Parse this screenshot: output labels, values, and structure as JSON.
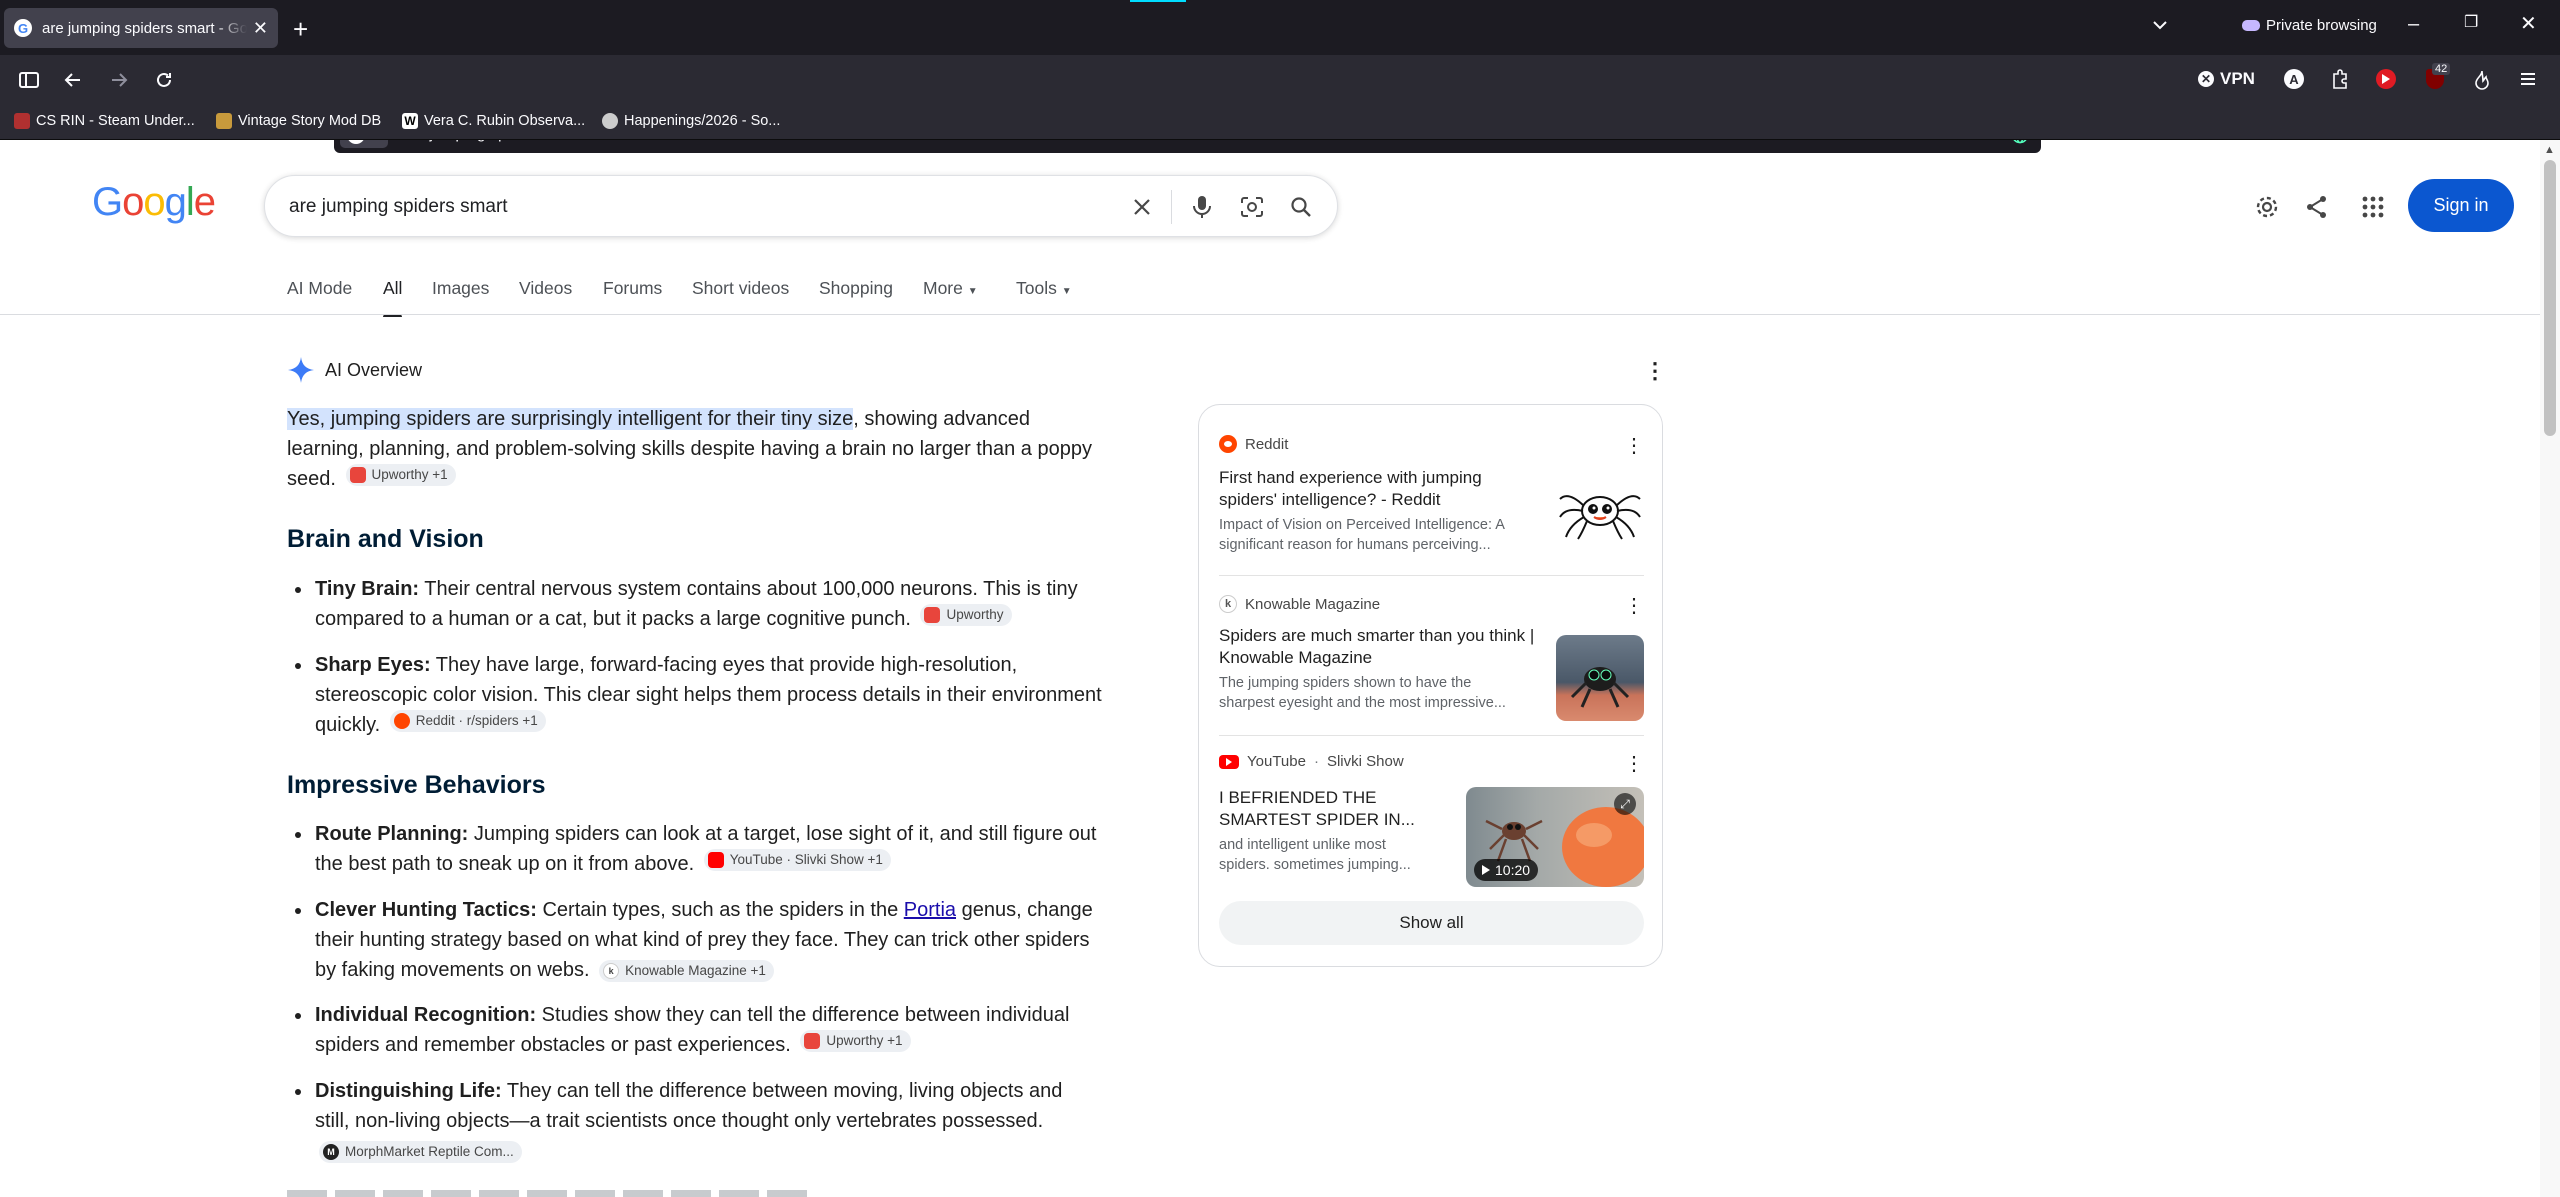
{
  "browser": {
    "tab_title": "are jumping spiders smart - Google Search",
    "new_tab": "+",
    "private_label": "Private browsing",
    "url": "are jumping spiders smart",
    "vpn_label": "VPN",
    "ext_badge": "42",
    "bookmarks": [
      "CS RIN - Steam Under...",
      "Vintage Story Mod DB",
      "Vera C. Rubin Observa...",
      "Happenings/2026 - So..."
    ]
  },
  "google": {
    "logo": [
      "G",
      "o",
      "o",
      "g",
      "l",
      "e"
    ],
    "query": "are jumping spiders smart",
    "signin": "Sign in",
    "tabs": [
      "AI Mode",
      "All",
      "Images",
      "Videos",
      "Forums",
      "Short videos",
      "Shopping",
      "More",
      "Tools"
    ]
  },
  "overview": {
    "heading": "AI Overview",
    "intro_highlight": "Yes, jumping spiders are surprisingly intelligent for their tiny size",
    "intro_rest": ", showing advanced learning, planning, and problem-solving skills despite having a brain no larger than a poppy seed.",
    "intro_chip": "Upworthy +1",
    "section1": "Brain and Vision",
    "b1_label": "Tiny Brain:",
    "b1_text": " Their central nervous system contains about 100,000 neurons. This is tiny compared to a human or a cat, but it packs a large cognitive punch.",
    "b1_chip": "Upworthy",
    "b2_label": "Sharp Eyes:",
    "b2_text": " They have large, forward-facing eyes that provide high-resolution, stereoscopic color vision. This clear sight helps them process details in their environment quickly.",
    "b2_chip": "Reddit · r/spiders +1",
    "section2": "Impressive Behaviors",
    "b3_label": "Route Planning:",
    "b3_text": " Jumping spiders can look at a target, lose sight of it, and still figure out the best path to sneak up on it from above.",
    "b3_chip": "YouTube · Slivki Show +1",
    "b4_label": "Clever Hunting Tactics:",
    "b4_text_a": " Certain types, such as the spiders in the ",
    "b4_link": "Portia",
    "b4_text_b": " genus, change their hunting strategy based on what kind of prey they face. They can trick other spiders by faking movements on webs.",
    "b4_chip": "Knowable Magazine +1",
    "b5_label": "Individual Recognition:",
    "b5_text": " Studies show they can tell the difference between individual spiders and remember obstacles or past experiences.",
    "b5_chip": "Upworthy +1",
    "b6_label": "Distinguishing Life:",
    "b6_text": " They can tell the difference between moving, living objects and still, non-living objects—a trait scientists once thought only vertebrates possessed.",
    "b6_chip": "MorphMarket Reptile Com..."
  },
  "sources": [
    {
      "site": "Reddit",
      "title": "First hand experience with jumping spiders' intelligence? - Reddit",
      "snippet": "Impact of Vision on Perceived Intelligence: A significant reason for humans perceiving..."
    },
    {
      "site": "Knowable Magazine",
      "title": "Spiders are much smarter than you think | Knowable Magazine",
      "snippet": "The jumping spiders shown to have the sharpest eyesight and the most impressive..."
    },
    {
      "site": "YouTube",
      "channel": "Slivki Show",
      "title": "I BEFRIENDED THE SMARTEST SPIDER IN...",
      "snippet": "and intelligent unlike most spiders. sometimes jumping...",
      "duration": "10:20"
    }
  ],
  "show_all": "Show all"
}
